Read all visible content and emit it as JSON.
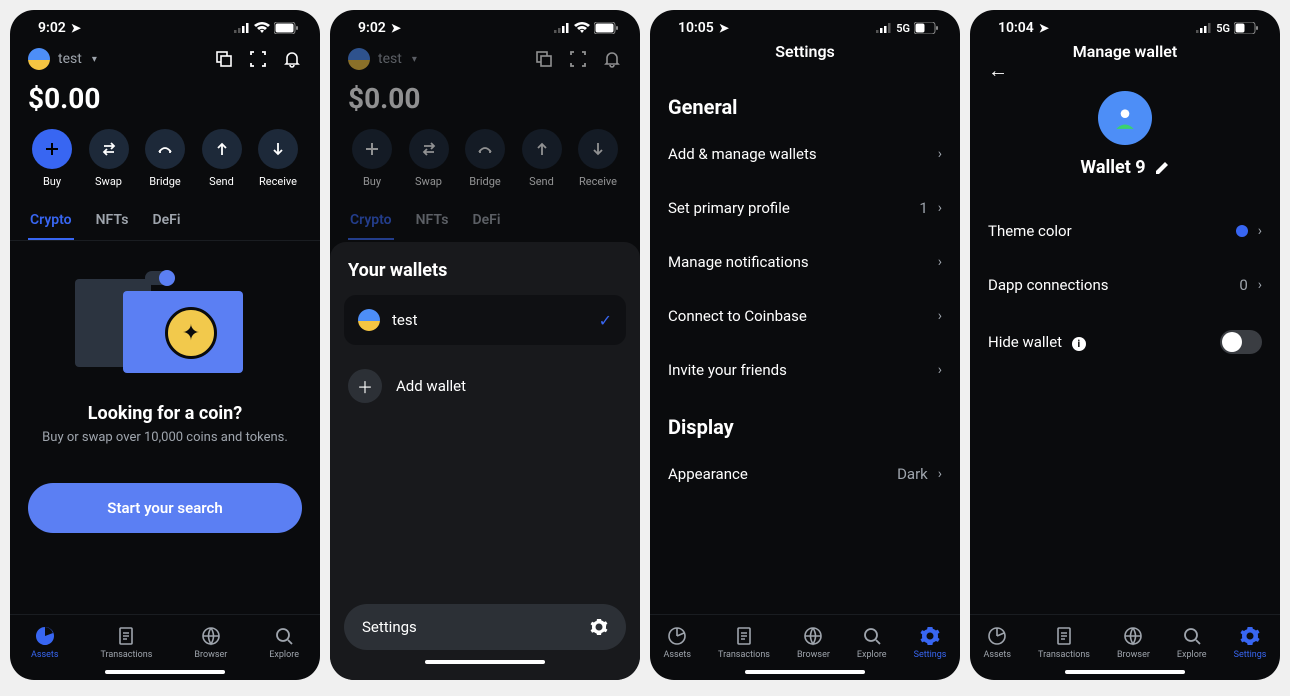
{
  "screens": [
    {
      "status": {
        "time": "9:02",
        "net": "wifi"
      },
      "account": "test",
      "balance": "$0.00",
      "actions": [
        {
          "label": "Buy",
          "icon": "plus",
          "primary": true
        },
        {
          "label": "Swap",
          "icon": "swap"
        },
        {
          "label": "Bridge",
          "icon": "bridge"
        },
        {
          "label": "Send",
          "icon": "up"
        },
        {
          "label": "Receive",
          "icon": "down"
        }
      ],
      "tabs": [
        "Crypto",
        "NFTs",
        "DeFi"
      ],
      "active_tab": "Crypto",
      "empty": {
        "title": "Looking for a coin?",
        "subtitle": "Buy or swap over 10,000 coins and tokens."
      },
      "cta": "Start your search",
      "nav_active": "Assets"
    },
    {
      "status": {
        "time": "9:02",
        "net": "wifi"
      },
      "account": "test",
      "balance": "$0.00",
      "actions": [
        {
          "label": "Buy",
          "icon": "plus"
        },
        {
          "label": "Swap",
          "icon": "swap"
        },
        {
          "label": "Bridge",
          "icon": "bridge"
        },
        {
          "label": "Send",
          "icon": "up"
        },
        {
          "label": "Receive",
          "icon": "down"
        }
      ],
      "tabs": [
        "Crypto",
        "NFTs",
        "DeFi"
      ],
      "sheet": {
        "title": "Your wallets",
        "wallets": [
          {
            "name": "test",
            "selected": true
          }
        ],
        "add_label": "Add wallet",
        "settings_label": "Settings"
      }
    },
    {
      "status": {
        "time": "10:05",
        "net": "5G"
      },
      "page_title": "Settings",
      "sections": {
        "general": {
          "heading": "General",
          "rows": [
            {
              "label": "Add & manage wallets",
              "value": ""
            },
            {
              "label": "Set primary profile",
              "value": "1"
            },
            {
              "label": "Manage notifications",
              "value": ""
            },
            {
              "label": "Connect to Coinbase",
              "value": ""
            },
            {
              "label": "Invite your friends",
              "value": ""
            }
          ]
        },
        "display": {
          "heading": "Display",
          "rows": [
            {
              "label": "Appearance",
              "value": "Dark"
            }
          ]
        }
      },
      "nav_active": "Settings"
    },
    {
      "status": {
        "time": "10:04",
        "net": "5G"
      },
      "page_title": "Manage wallet",
      "wallet_name": "Wallet 9",
      "rows": [
        {
          "label": "Theme color",
          "kind": "color"
        },
        {
          "label": "Dapp connections",
          "value": "0"
        },
        {
          "label": "Hide wallet",
          "kind": "toggle"
        }
      ],
      "nav_active": "Settings"
    }
  ],
  "nav": [
    {
      "label": "Assets",
      "icon": "pie"
    },
    {
      "label": "Transactions",
      "icon": "doc"
    },
    {
      "label": "Browser",
      "icon": "globe"
    },
    {
      "label": "Explore",
      "icon": "search"
    },
    {
      "label": "Settings",
      "icon": "gear"
    }
  ]
}
